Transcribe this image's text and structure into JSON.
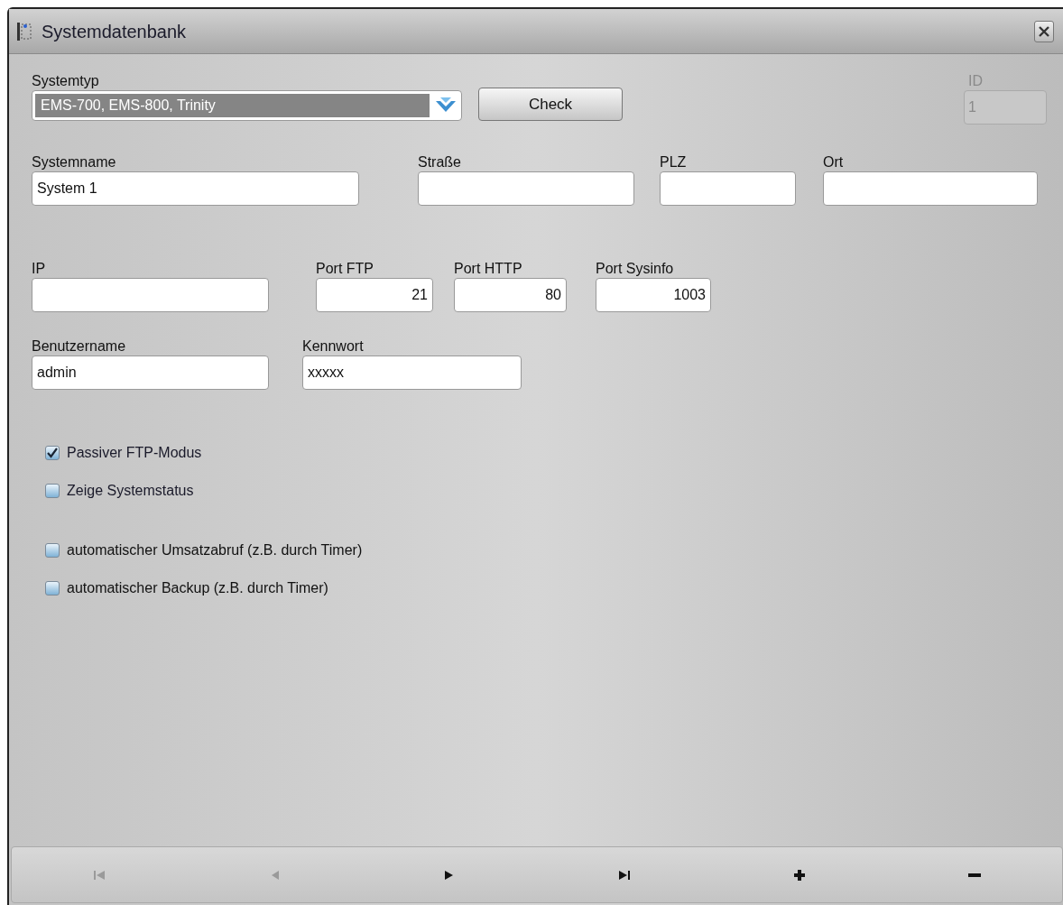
{
  "window": {
    "title": "Systemdatenbank"
  },
  "system_type": {
    "label": "Systemtyp",
    "value": "EMS-700, EMS-800, Trinity"
  },
  "check_button": "Check",
  "id_field": {
    "label": "ID",
    "value": "1",
    "disabled": true
  },
  "field_rows": [
    [
      {
        "label": "Systemname",
        "value": "System 1",
        "kind": "text"
      },
      {
        "label": "Straße",
        "kind": "text"
      },
      {
        "label": "PLZ",
        "kind": "text"
      },
      {
        "label": "Ort",
        "kind": "text"
      }
    ],
    [
      {
        "label": "IP",
        "kind": "text"
      },
      {
        "label": "Port FTP",
        "value": "21",
        "kind": "number"
      },
      {
        "label": "Port HTTP",
        "value": "80",
        "kind": "number"
      },
      {
        "label": "Port Sysinfo",
        "value": "1003",
        "kind": "number"
      }
    ],
    [
      {
        "label": "Benutzername",
        "value": "admin",
        "kind": "text"
      },
      {
        "label": "Kennwort",
        "value": "xxxxx",
        "kind": "text"
      }
    ]
  ],
  "option_groups": [
    [
      {
        "label": "Passiver FTP-Modus",
        "checked": true
      },
      {
        "label": "Zeige Systemstatus",
        "checked": false
      }
    ],
    [
      {
        "label": "automatischer Umsatzabruf (z.B. durch Timer)",
        "checked": false
      },
      {
        "label": "automatischer Backup (z.B. durch Timer)",
        "checked": false
      }
    ]
  ],
  "navigator": [
    {
      "kind": "first",
      "disabled": true
    },
    {
      "kind": "prev",
      "disabled": true
    },
    {
      "kind": "next",
      "disabled": false
    },
    {
      "kind": "last",
      "disabled": false
    },
    {
      "kind": "add",
      "disabled": false
    },
    {
      "kind": "remove",
      "disabled": false
    }
  ]
}
